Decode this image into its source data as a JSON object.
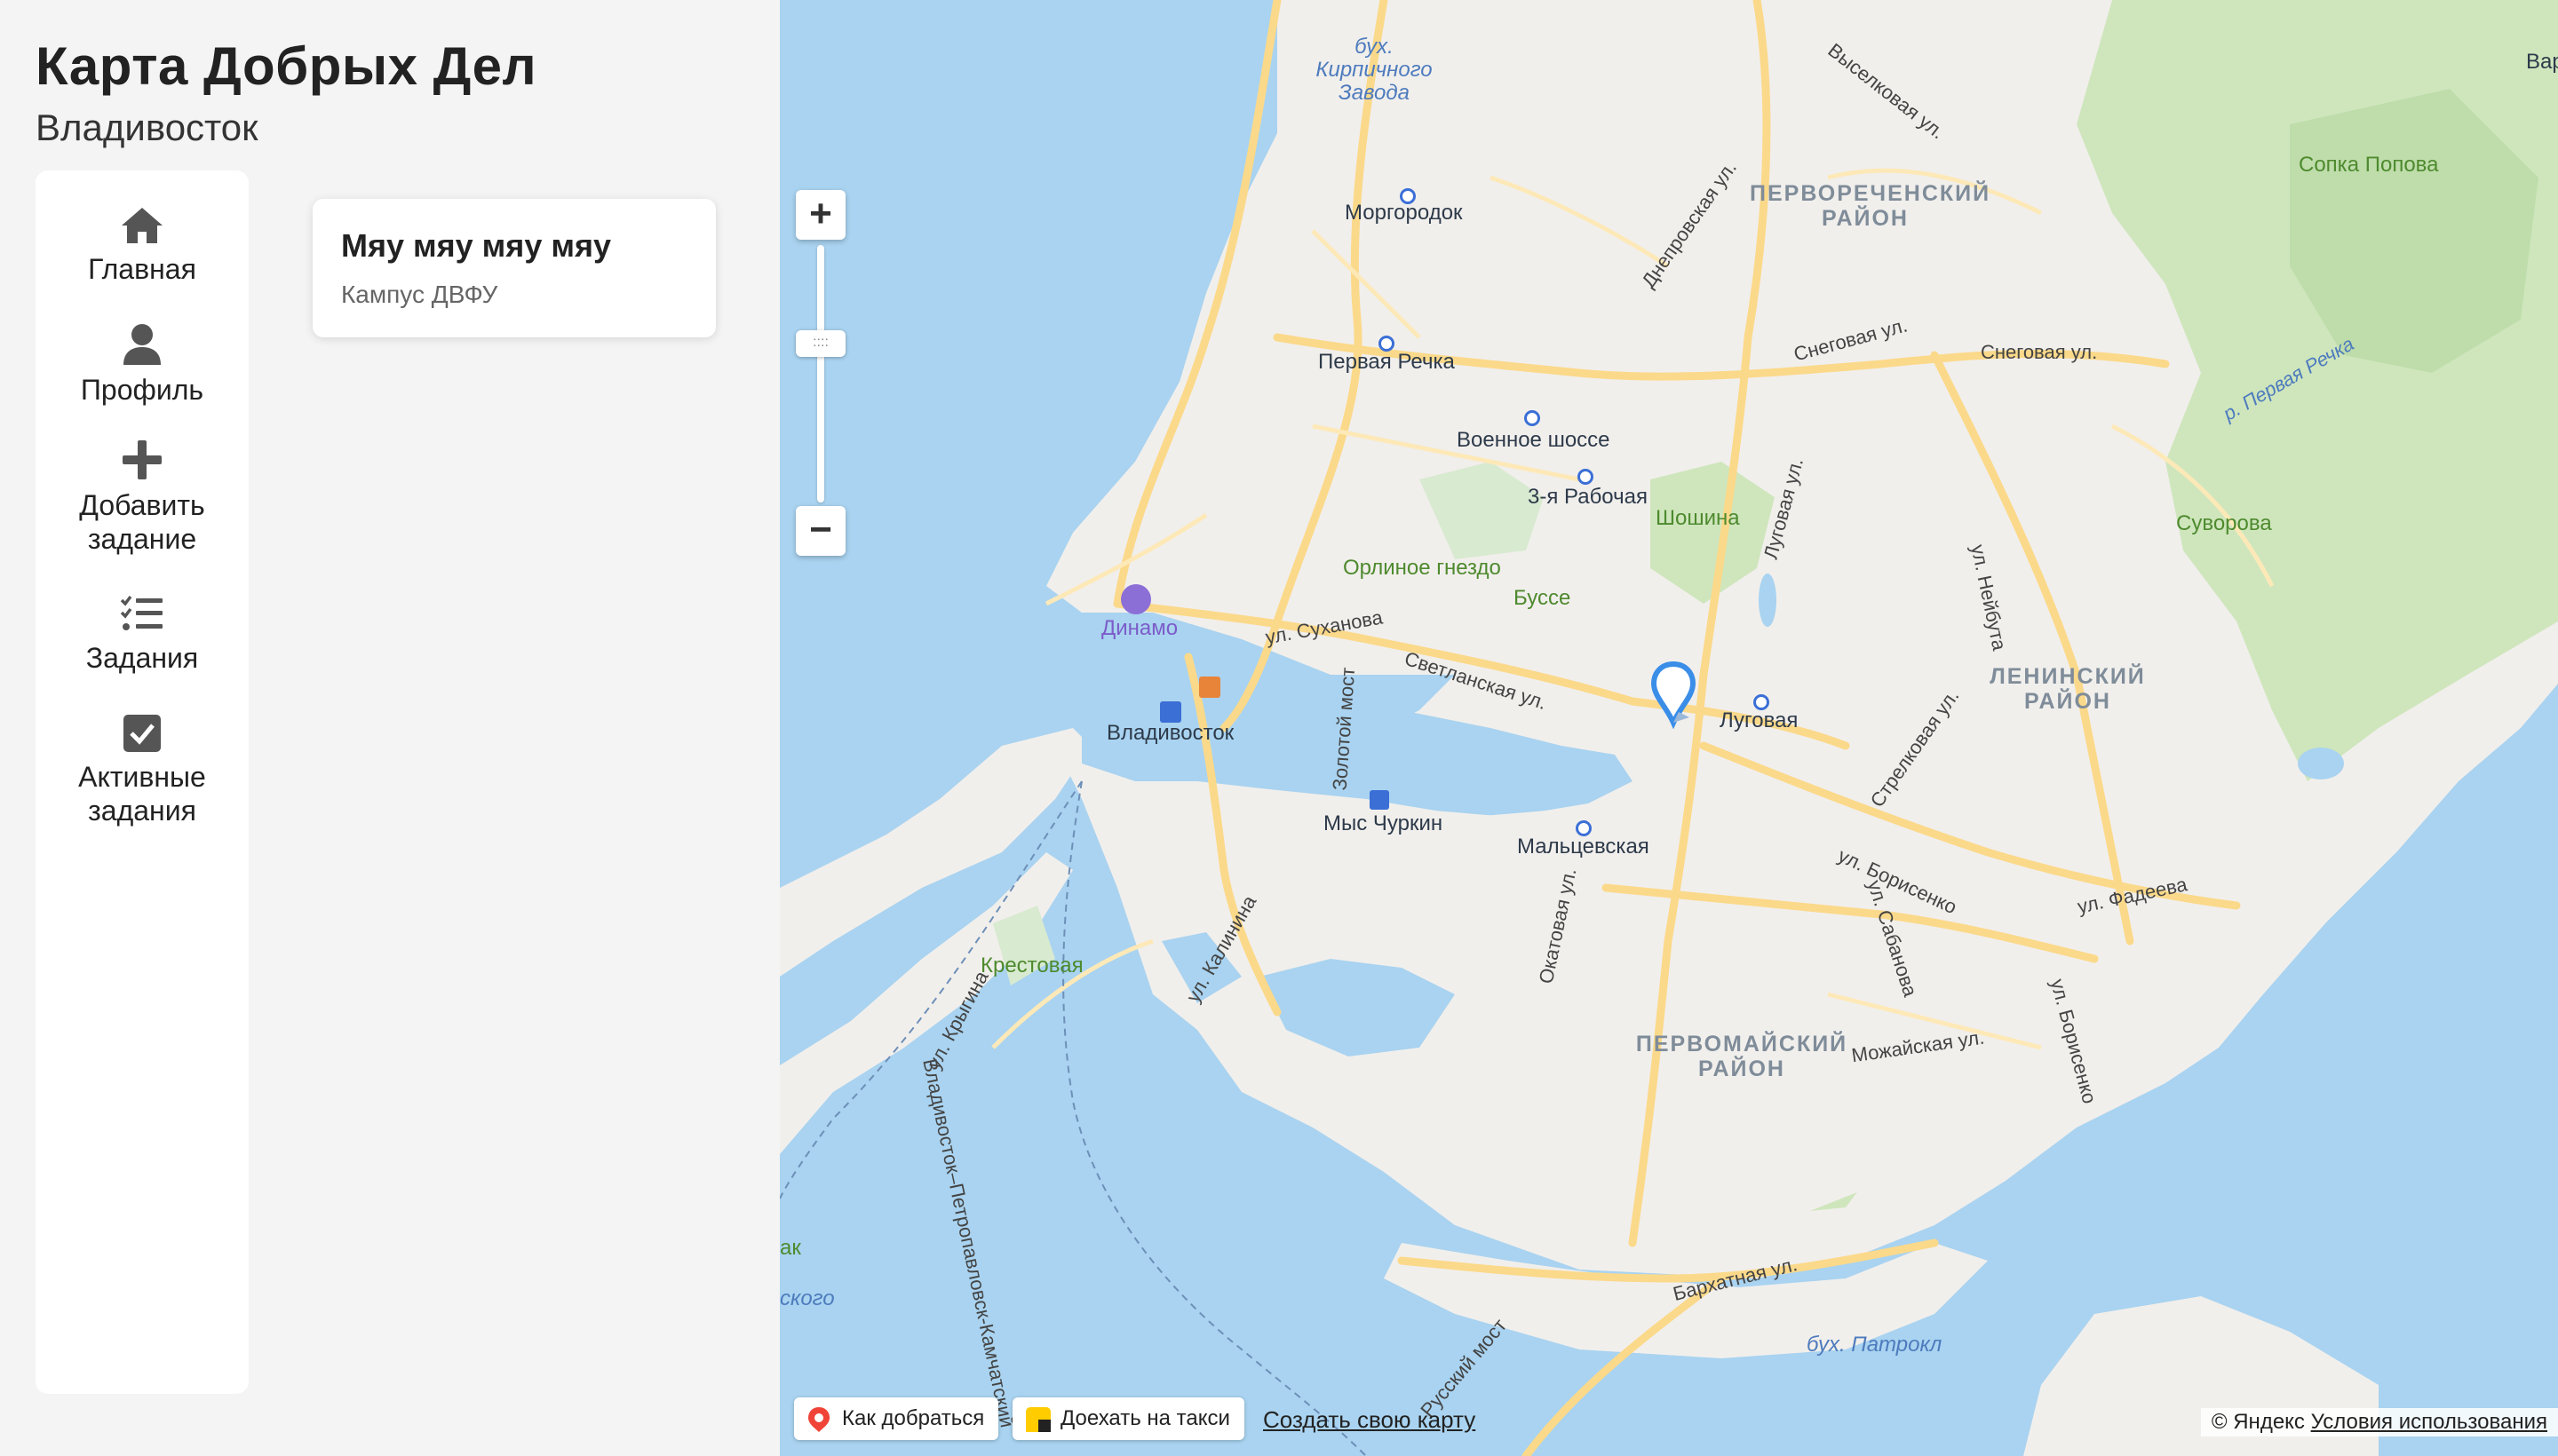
{
  "app": {
    "title": "Карта Добрых Дел",
    "city": "Владивосток"
  },
  "nav": [
    {
      "label": "Главная",
      "icon": "home-icon"
    },
    {
      "label": "Профиль",
      "icon": "user-icon"
    },
    {
      "label": "Добавить задание",
      "icon": "plus-icon"
    },
    {
      "label": "Задания",
      "icon": "list-check-icon"
    },
    {
      "label": "Активные задания",
      "icon": "checkbox-icon"
    }
  ],
  "task": {
    "title": "Мяу мяу мяу мяу",
    "place": "Кампус ДВФУ"
  },
  "map": {
    "labels": {
      "kirpich": "бух. Кирпичного Завода",
      "morgorodok": "Моргородок",
      "pervaya_rechka": "Первая Речка",
      "voennoe": "Военное шоссе",
      "tretya_rabochaya": "3-я Рабочая",
      "shoshina": "Шошина",
      "orlinoe": "Орлиное гнездо",
      "busse": "Буссе",
      "dinamo": "Динамо",
      "vladivostok": "Владивосток",
      "lugovaya": "Луговая",
      "mys_churkin": "Мыс Чуркин",
      "maltsevskaya": "Мальцевская",
      "krestovaya": "Крестовая",
      "sopka_popova": "Сопка Попова",
      "suvorova": "Суворова",
      "pervorechensky": "ПЕРВОРЕЧЕНСКИЙ РАЙОН",
      "leninsky": "ЛЕНИНСКИЙ РАЙОН",
      "pervomaysky": "ПЕРВОМАЙСКИЙ РАЙОН",
      "patrokl": "бух. Патрокл",
      "vyselkovaya": "Выселковая ул.",
      "dneprovskaya": "Днепровская ул.",
      "snegovaya1": "Снеговая ул.",
      "snegovaya2": "Снеговая ул.",
      "pervaya_rechka_river": "р. Первая Речка",
      "lugovaya_ul": "Луговая ул.",
      "neybuta": "ул. Нейбута",
      "sukhanova": "ул. Суханова",
      "svetlanskaya": "Светланская ул.",
      "zolotoy_most": "Золотой мост",
      "strelkovaya": "Стрелковая ул.",
      "borisenko": "ул. Борисенко",
      "fadeeva": "ул. Фадеева",
      "sabanova": "ул. Сабанова",
      "kalinina": "ул. Калинина",
      "okatovaya": "Окатовая ул.",
      "krygina": "ул. Крыгина",
      "vl_petropavlovsk": "Владивосток–Петропавловск-Камчатский",
      "mozhayskaya": "Можайская ул.",
      "borisenko2": "ул. Борисенко",
      "barkhatnaya": "Бархатная ул.",
      "russky_most": "Русский мост",
      "vary": "Вар",
      "ak": "ак",
      "skogo": "ского"
    },
    "buttons": {
      "route": "Как добраться",
      "taxi": "Доехать на такси",
      "create": "Создать свою карту"
    },
    "copyright": "© Яндекс",
    "terms": "Условия использования",
    "zoom_in": "+",
    "zoom_out": "−",
    "zoom_handle": "::::"
  },
  "colors": {
    "accent": "#3a8ee8",
    "water": "#a9d3f0",
    "land": "#f1efec",
    "road": "#fbd98a",
    "green": "#cfe6bd"
  }
}
